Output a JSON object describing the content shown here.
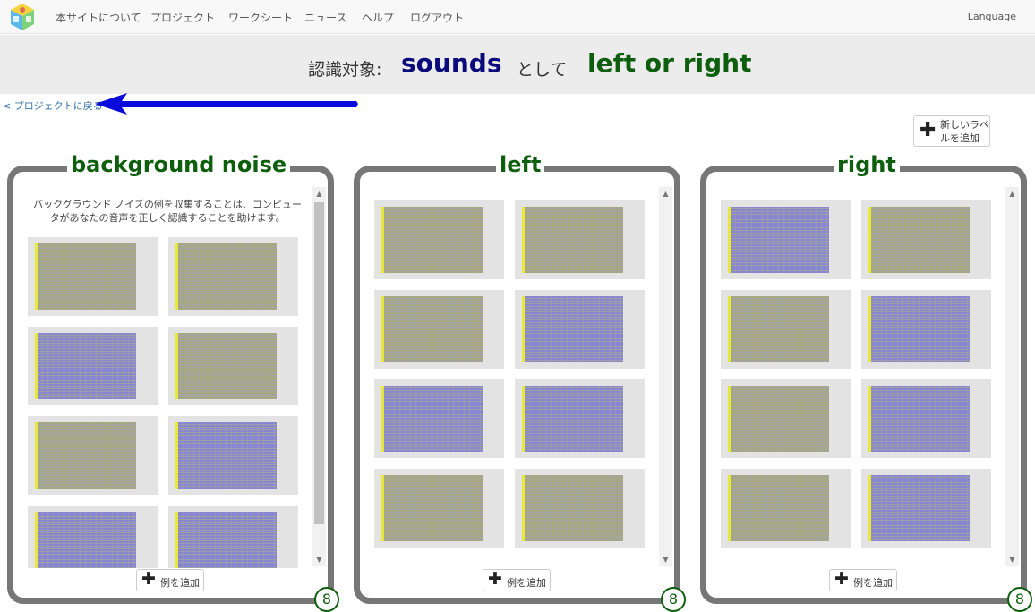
{
  "nav": {
    "items": [
      "本サイトについて",
      "プロジェクト",
      "ワークシート",
      "ニュース",
      "ヘルプ",
      "ログアウト"
    ],
    "language": "Language"
  },
  "heading": {
    "prefix": "認識対象:",
    "type": "sounds",
    "middle": "として",
    "project": "left or right"
  },
  "back_link": "< プロジェクトに戻る",
  "add_label_button": "新しいラベルを追加",
  "colors": {
    "title_green": "#0d5e0d",
    "type_navy": "#0a0a7a",
    "bucket_border": "#777777",
    "arrow_blue": "#0a0adc"
  },
  "buckets": [
    {
      "title": "background noise",
      "message": "バックグラウンド ノイズの例を収集することは、コンピュータがあなたの音声を正しく認識することを助けます。",
      "add_example": "例を追加",
      "count": "8",
      "spectrograms": [
        "yellow",
        "yellow",
        "blue",
        "yellow",
        "yellow",
        "blue",
        "blue",
        "blue"
      ]
    },
    {
      "title": "left",
      "message": "",
      "add_example": "例を追加",
      "count": "8",
      "spectrograms": [
        "yellow",
        "yellow",
        "yellow",
        "blue",
        "blue",
        "blue",
        "yellow",
        "yellow"
      ]
    },
    {
      "title": "right",
      "message": "",
      "add_example": "例を追加",
      "count": "8",
      "spectrograms": [
        "blue",
        "yellow",
        "yellow",
        "blue",
        "yellow",
        "blue",
        "yellow",
        "blue"
      ]
    }
  ]
}
